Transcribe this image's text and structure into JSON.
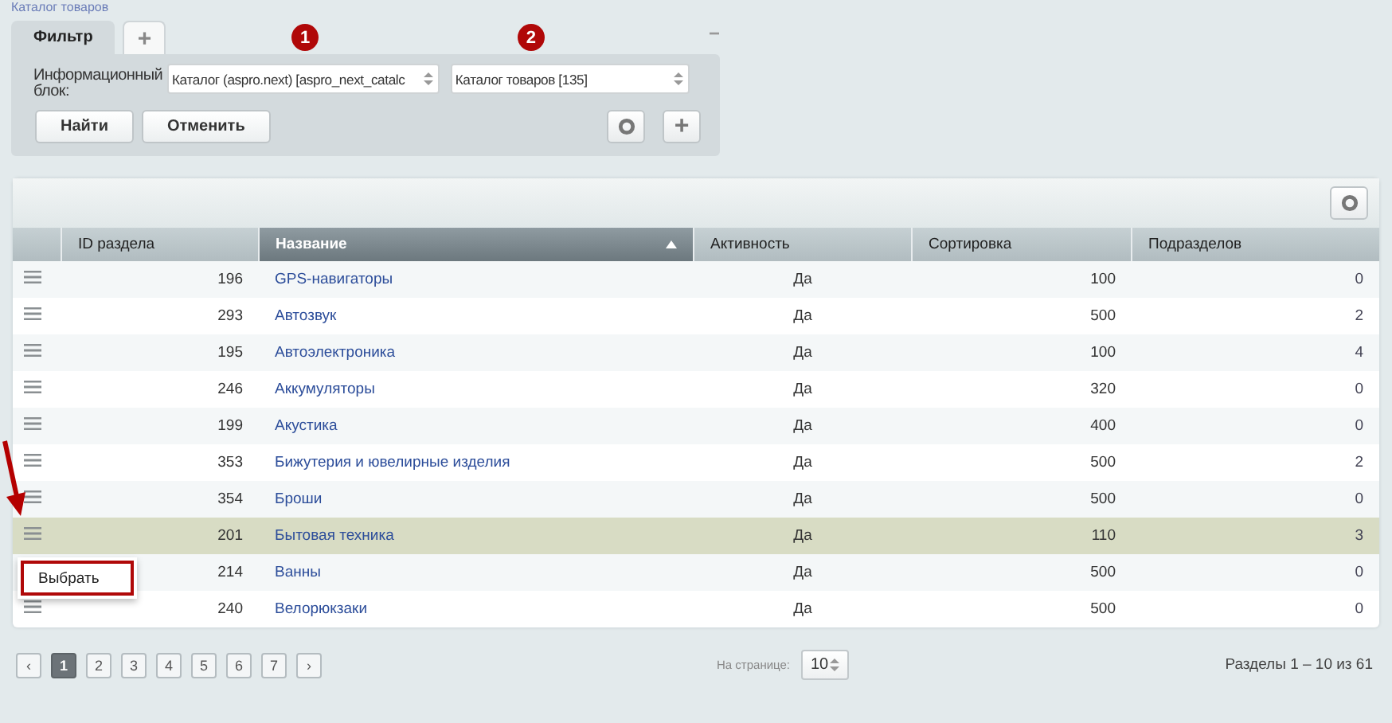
{
  "breadcrumb": "Каталог товаров",
  "filter": {
    "tabs": [
      {
        "label": "Фильтр",
        "selected": true
      }
    ],
    "add_tab": "+",
    "collapse": "−",
    "field_label": "Информационный блок:",
    "fields": [
      {
        "value": "Каталог (aspro.next) [aspro_next_catalc",
        "marker": "1"
      },
      {
        "value": "Каталог товаров [135]",
        "marker": "2"
      }
    ],
    "buttons": [
      "Найти",
      "Отменить"
    ],
    "add_button": "+"
  },
  "table": {
    "columns": [
      {
        "label": "ID раздела",
        "sorted": false
      },
      {
        "label": "Название",
        "sorted": true
      },
      {
        "label": "Активность",
        "sorted": false
      },
      {
        "label": "Сортировка",
        "sorted": false
      },
      {
        "label": "Подразделов",
        "sorted": false
      }
    ],
    "rows": [
      {
        "id": "196",
        "name": "GPS-навигаторы",
        "active": "Да",
        "sort": "100",
        "sub": "0",
        "selected": false
      },
      {
        "id": "293",
        "name": "Автозвук",
        "active": "Да",
        "sort": "500",
        "sub": "2",
        "selected": false
      },
      {
        "id": "195",
        "name": "Автоэлектроника",
        "active": "Да",
        "sort": "100",
        "sub": "4",
        "selected": false
      },
      {
        "id": "246",
        "name": "Аккумуляторы",
        "active": "Да",
        "sort": "320",
        "sub": "0",
        "selected": false
      },
      {
        "id": "199",
        "name": "Акустика",
        "active": "Да",
        "sort": "400",
        "sub": "0",
        "selected": false
      },
      {
        "id": "353",
        "name": "Бижутерия и ювелирные изделия",
        "active": "Да",
        "sort": "500",
        "sub": "2",
        "selected": false
      },
      {
        "id": "354",
        "name": "Броши",
        "active": "Да",
        "sort": "500",
        "sub": "0",
        "selected": false
      },
      {
        "id": "201",
        "name": "Бытовая техника",
        "active": "Да",
        "sort": "110",
        "sub": "3",
        "selected": true
      },
      {
        "id": "214",
        "name": "Ванны",
        "active": "Да",
        "sort": "500",
        "sub": "0",
        "selected": false
      },
      {
        "id": "240",
        "name": "Велорюкзаки",
        "active": "Да",
        "sort": "500",
        "sub": "0",
        "selected": false
      }
    ],
    "context_menu": {
      "items": [
        "Выбрать"
      ]
    }
  },
  "pagination": {
    "prev": "‹",
    "next": "›",
    "pages": [
      {
        "label": "1",
        "selected": true
      },
      {
        "label": "2",
        "selected": false
      },
      {
        "label": "3",
        "selected": false
      },
      {
        "label": "4",
        "selected": false
      },
      {
        "label": "5",
        "selected": false
      },
      {
        "label": "6",
        "selected": false
      },
      {
        "label": "7",
        "selected": false
      }
    ],
    "per_page_label": "На странице:",
    "per_page": "10",
    "summary": "Разделы 1 – 10 из 61"
  }
}
